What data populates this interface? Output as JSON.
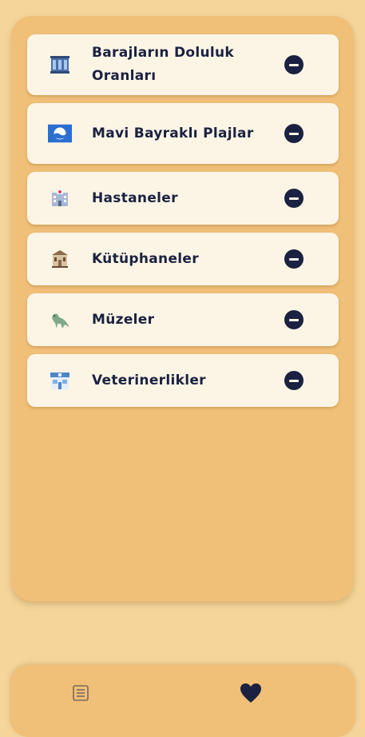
{
  "favorites": {
    "items": [
      {
        "label": "Barajların Doluluk Oranları",
        "icon": "dam-icon"
      },
      {
        "label": "Mavi Bayraklı Plajlar",
        "icon": "blue-flag-icon"
      },
      {
        "label": "Hastaneler",
        "icon": "hospital-icon"
      },
      {
        "label": "Kütüphaneler",
        "icon": "library-icon"
      },
      {
        "label": "Müzeler",
        "icon": "dinosaur-icon"
      },
      {
        "label": "Veterinerlikler",
        "icon": "vet-clinic-icon"
      }
    ],
    "remove_icon": "minus-circle-icon"
  },
  "bottom_nav": {
    "items": [
      {
        "icon": "list-icon",
        "active": false
      },
      {
        "icon": "heart-icon",
        "active": true
      }
    ]
  },
  "colors": {
    "background": "#f5d59a",
    "panel": "#f0bf78",
    "card": "#fcf5e6",
    "text": "#1b2140"
  }
}
